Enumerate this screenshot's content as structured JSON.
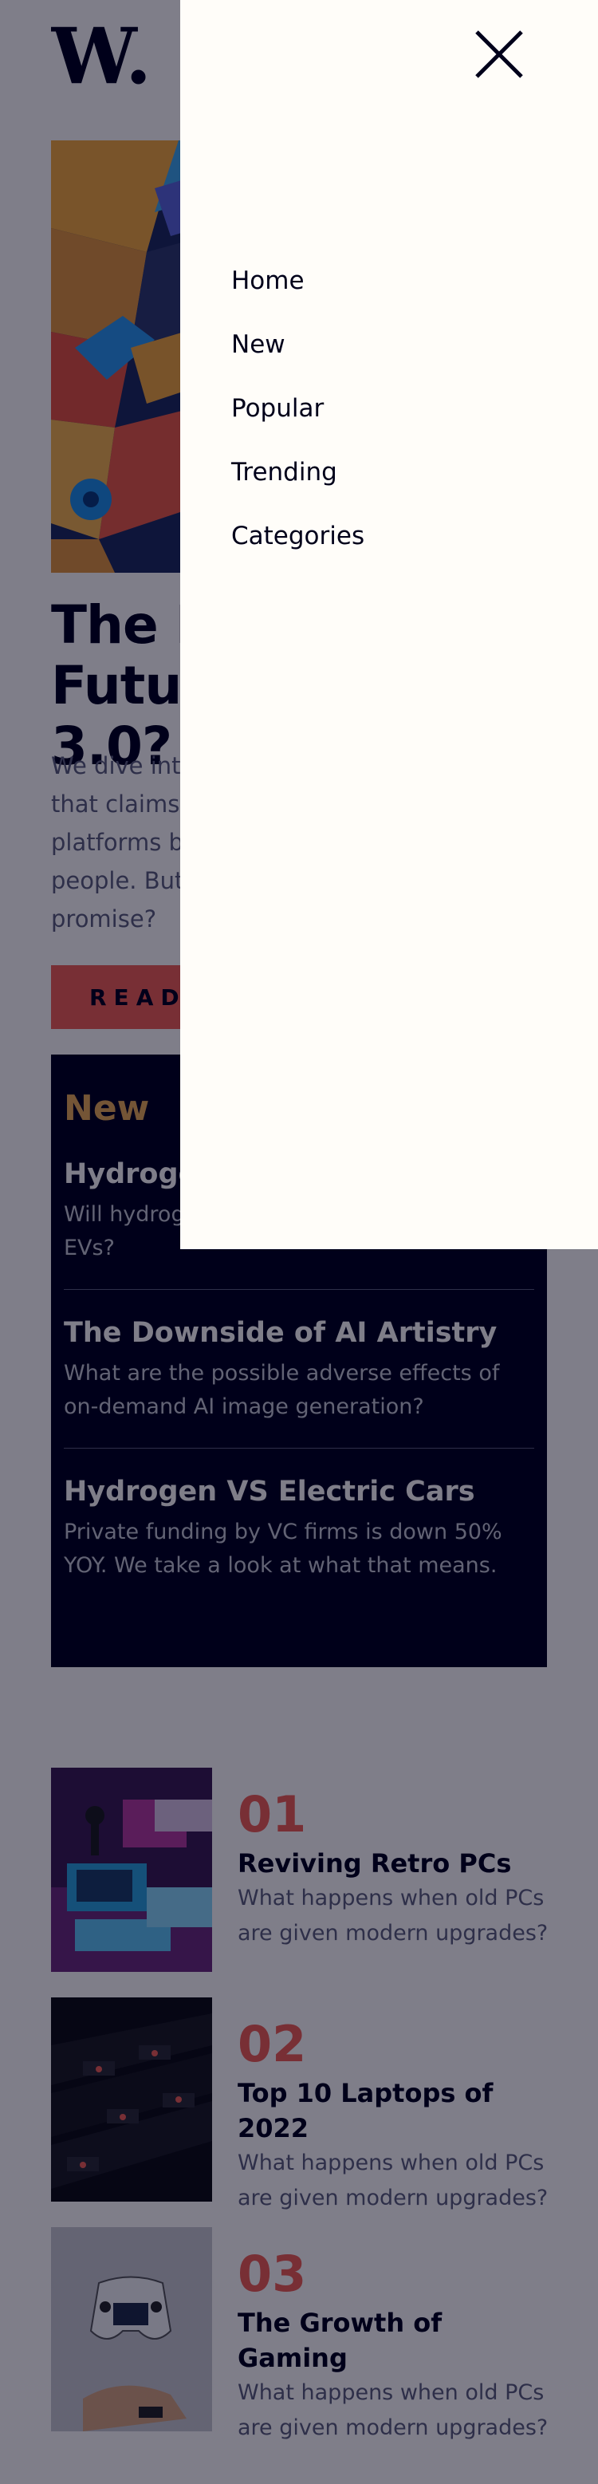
{
  "header": {
    "logo_text": "W."
  },
  "hero": {
    "title": "The Bright Future of Web 3.0?",
    "description": "We dive into the next evolution of the web that claims to put the power of the platforms back into the hands of the people. But is it really fulfilling its promise?",
    "cta_label": "READ MORE"
  },
  "new_section": {
    "heading": "New",
    "items": [
      {
        "title": "Hydrogen VS Electric Cars",
        "text": "Will hydrogen-fueled cars ever catch up to EVs?"
      },
      {
        "title": "The Downside of AI Artistry",
        "text": "What are the possible adverse effects of on-demand AI image generation?"
      },
      {
        "title": "Hydrogen VS Electric Cars",
        "text": "Private funding by VC firms is down 50% YOY. We take a look at what that means."
      }
    ]
  },
  "ranked": [
    {
      "number": "01",
      "title": "Reviving Retro PCs",
      "text": "What happens when old PCs are given modern upgrades?"
    },
    {
      "number": "02",
      "title": "Top 10 Laptops of 2022",
      "text": "What happens when old PCs are given modern upgrades?"
    },
    {
      "number": "03",
      "title": "The Growth of Gaming",
      "text": "What happens when old PCs are given modern upgrades?"
    }
  ],
  "menu": {
    "items": [
      {
        "label": "Home"
      },
      {
        "label": "New"
      },
      {
        "label": "Popular"
      },
      {
        "label": "Trending"
      },
      {
        "label": "Categories"
      }
    ]
  },
  "icons": {
    "close": "close-icon",
    "logo": "logo-icon"
  },
  "colors": {
    "background": "#fffdf9",
    "dark_navy": "#00001a",
    "soft_red": "#f15e50",
    "soft_orange": "#e9ab53",
    "grayish_blue": "#5d5f79",
    "overlay": "rgba(0,0,26,0.5)"
  }
}
